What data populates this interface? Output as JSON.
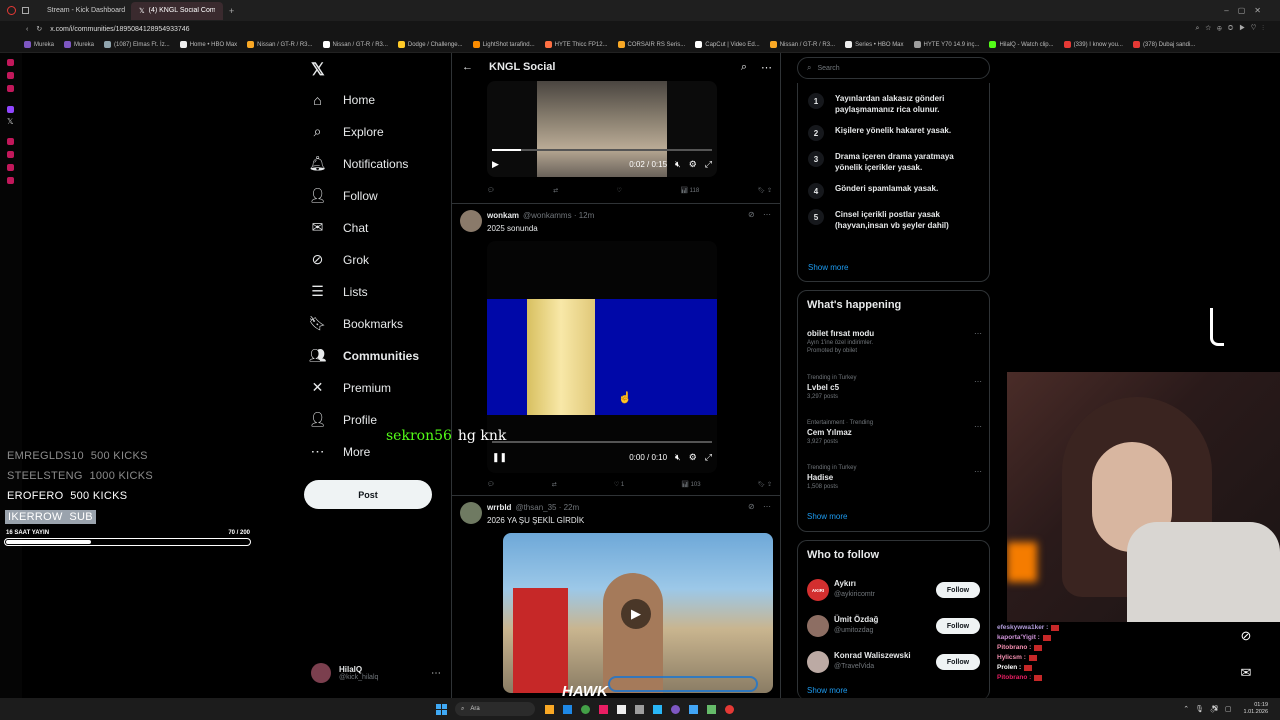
{
  "browser": {
    "tabs": [
      {
        "label": "Stream - Kick Dashboard",
        "active": false
      },
      {
        "label": "(4) KNGL Social Community",
        "active": true
      }
    ],
    "url": "x.com/i/communities/1895084128954933746",
    "bookmarks": [
      "Mureka",
      "Mureka",
      "(1087) Elmas Ft. İz...",
      "Home • HBO Max",
      "Nissan / GT-R / R3...",
      "Nissan / GT-R / R3...",
      "Dodge / Challenge...",
      "LightShot tarafind...",
      "HYTE Thicc FP12...",
      "CORSAIR RS Seris...",
      "CapCut | Video Ed...",
      "Nissan / GT-R / R3...",
      "Series • HBO Max",
      "HYTE Y70 14.9 inç...",
      "HilalQ - Watch clip...",
      "(339) I know you...",
      "(378) Dubaj sandi..."
    ]
  },
  "nav": {
    "items": [
      {
        "label": "Home",
        "icon": "home-icon",
        "glyph": "⌂",
        "bold": false
      },
      {
        "label": "Explore",
        "icon": "search-icon",
        "glyph": "⌕",
        "bold": false
      },
      {
        "label": "Notifications",
        "icon": "bell-icon",
        "glyph": "🔔︎",
        "bold": false
      },
      {
        "label": "Follow",
        "icon": "person-add-icon",
        "glyph": "👤︎",
        "bold": false
      },
      {
        "label": "Chat",
        "icon": "mail-icon",
        "glyph": "✉",
        "bold": false
      },
      {
        "label": "Grok",
        "icon": "grok-icon",
        "glyph": "⊘",
        "bold": false
      },
      {
        "label": "Lists",
        "icon": "list-icon",
        "glyph": "☰",
        "bold": false
      },
      {
        "label": "Bookmarks",
        "icon": "bookmark-icon",
        "glyph": "🔖︎",
        "bold": false
      },
      {
        "label": "Communities",
        "icon": "communities-icon",
        "glyph": "👥︎",
        "bold": true
      },
      {
        "label": "Premium",
        "icon": "x-logo-icon",
        "glyph": "✕",
        "bold": false
      },
      {
        "label": "Profile",
        "icon": "profile-icon",
        "glyph": "👤︎",
        "bold": false
      },
      {
        "label": "More",
        "icon": "more-circle-icon",
        "glyph": "⋯",
        "bold": false
      }
    ],
    "post_label": "Post",
    "user": {
      "name": "HilalQ",
      "handle": "@kick_hilalq"
    }
  },
  "feed": {
    "title": "KNGL Social",
    "video1": {
      "time": "0:02 / 0:15",
      "progress": 0.13
    },
    "actions1": {
      "views": "118"
    },
    "tweet2": {
      "name": "wonkam",
      "handle": "@wonkamms · 12m",
      "text": "2025 sonunda",
      "time": "0:00 / 0:10",
      "likes": "1",
      "views": "103",
      "progress": 0
    },
    "tweet3": {
      "name": "wrrbld",
      "handle": "@thsan_35 · 22m",
      "text": "2026 YA ŞU ŞEKİL GİRDİK"
    }
  },
  "right": {
    "search_placeholder": "Search",
    "rules": [
      {
        "num": "1",
        "text": "Yayınlardan alakasız gönderi paylaşmamanız rica olunur."
      },
      {
        "num": "2",
        "text": "Kişilere yönelik hakaret yasak."
      },
      {
        "num": "3",
        "text": "Drama içeren drama yaratmaya yönelik içerikler yasak."
      },
      {
        "num": "4",
        "text": "Gönderi spamlamak yasak."
      },
      {
        "num": "5",
        "text": "Cinsel içerikli postlar yasak (hayvan,insan vb şeyler dahil)"
      }
    ],
    "rules_show_more": "Show more",
    "happening_title": "What's happening",
    "trends": [
      {
        "meta": "",
        "title": "obilet fırsat modu",
        "posts": "Ayın 1'ine özel indirimler.",
        "promo": "Promoted by obilet"
      },
      {
        "meta": "Trending in Turkey",
        "title": "Lvbel c5",
        "posts": "3,297 posts",
        "promo": ""
      },
      {
        "meta": "Entertainment · Trending",
        "title": "Cem Yılmaz",
        "posts": "3,927 posts",
        "promo": ""
      },
      {
        "meta": "Trending in Turkey",
        "title": "Hadise",
        "posts": "1,508 posts",
        "promo": ""
      }
    ],
    "trends_show_more": "Show more",
    "who_title": "Who to follow",
    "follow": [
      {
        "name": "Aykırı",
        "handle": "@aykiricomtr",
        "avatar": "AKIRI",
        "color": "#d32f2f"
      },
      {
        "name": "Ümit Özdağ",
        "handle": "@umitozdag",
        "avatar": "",
        "color": "#8d6e63"
      },
      {
        "name": "Konrad Waliszewski",
        "handle": "@TravelVida",
        "avatar": "",
        "color": "#bcaaa4"
      }
    ],
    "follow_label": "Follow",
    "who_show_more": "Show more"
  },
  "overlay": {
    "kicks": [
      {
        "name": "EMREGLDS10",
        "amount": "500 KICKS"
      },
      {
        "name": "STEELSTENG",
        "amount": "1000 KICKS"
      },
      {
        "name": "EROFERO",
        "amount": "500 KICKS"
      },
      {
        "name": "IKERROW",
        "amount": "SUB"
      }
    ],
    "goal_label": "16 SAAT YAYIN",
    "goal_value": "70 / 200",
    "goal_progress": 0.35,
    "chat_user": "sekron56",
    "chat_msg": "hg knk",
    "side_chat": [
      {
        "user": "efeskywwa1ker :",
        "color": "#b39ddb"
      },
      {
        "user": "kaporta'Yigit :",
        "color": "#ce93d8"
      },
      {
        "user": "Pitobrano :",
        "color": "#f48fb1"
      },
      {
        "user": "Hylicsm :",
        "color": "#f48fb1"
      },
      {
        "user": "Prolen :",
        "color": "#ffffff"
      },
      {
        "user": "Pitobrano :",
        "color": "#e91e63"
      }
    ],
    "watermark": "HAWK"
  },
  "taskbar": {
    "search": "Ara",
    "time": "01:19",
    "date": "1.01.2026"
  }
}
